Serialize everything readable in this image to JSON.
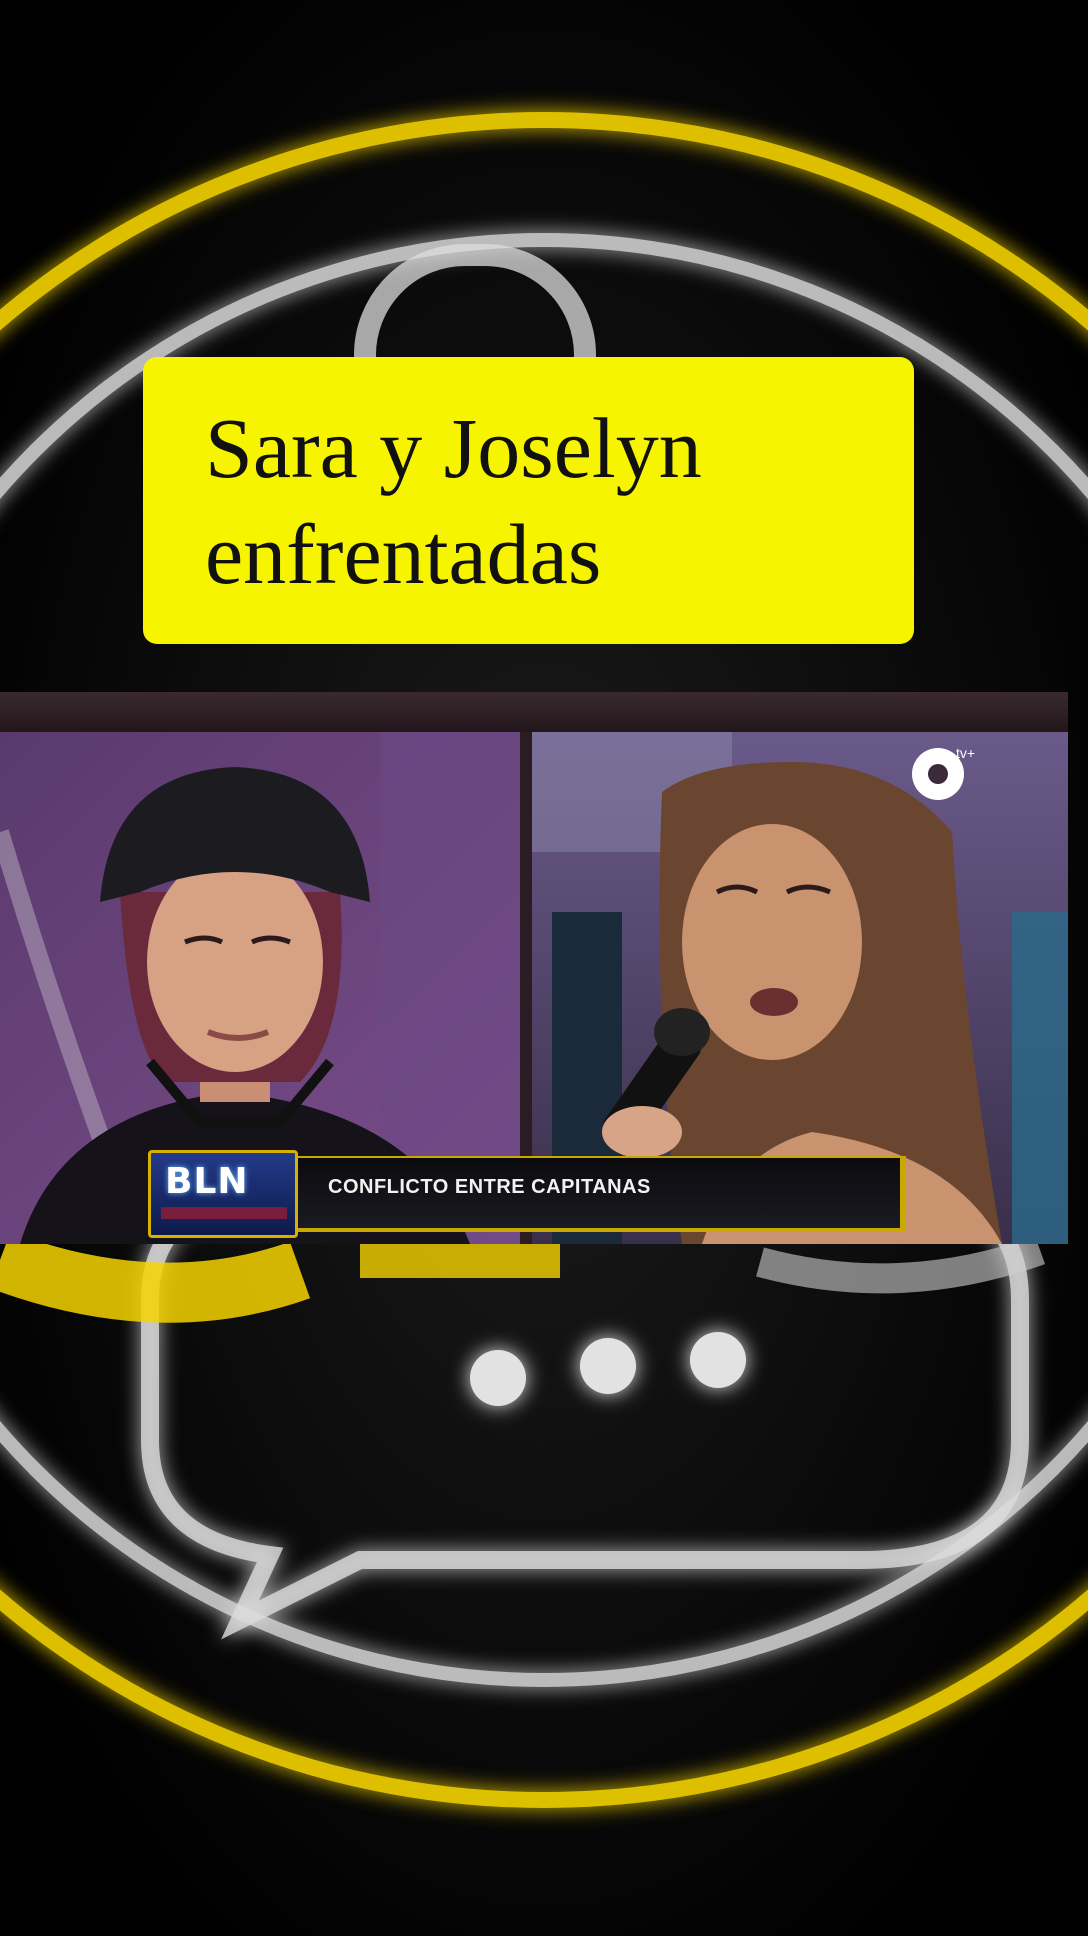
{
  "caption": {
    "line1": "Sara y Joselyn",
    "line2": "enfrentadas"
  },
  "video": {
    "lower_third_text": "CONFLICTO ENTRE CAPITANAS",
    "show_logo_text": "BLN",
    "channel_logo_text": "tv+"
  },
  "colors": {
    "caption_bg": "#f7f400",
    "ring_glow": "#f5d400",
    "background": "#000000"
  },
  "icons": [
    "chat-bubble-icon",
    "microphone-icon",
    "channel-logo-icon"
  ]
}
